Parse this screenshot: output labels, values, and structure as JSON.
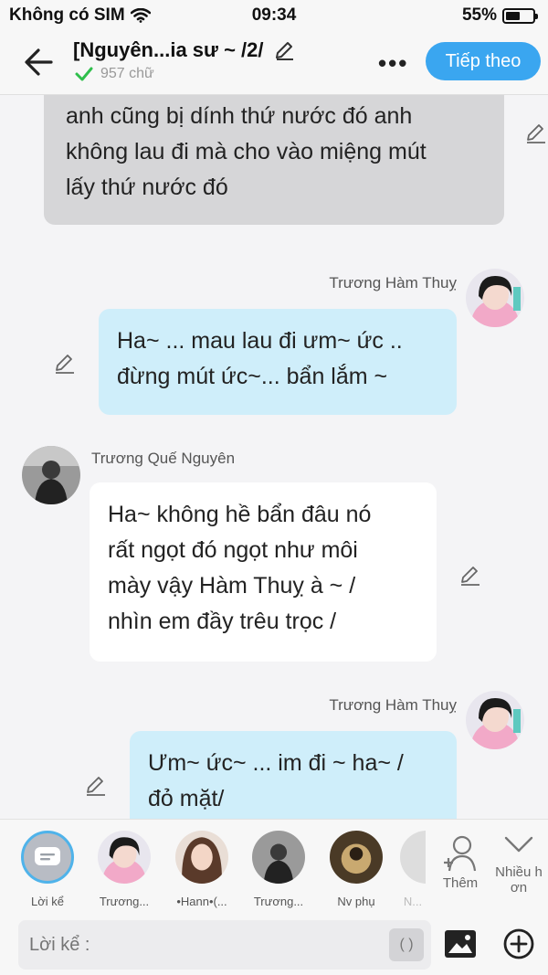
{
  "status_bar": {
    "carrier": "Không có SIM",
    "time": "09:34",
    "battery_percent": "55%",
    "battery_level": 0.55
  },
  "header": {
    "title": "[Nguyên...ia sư ~ /2/",
    "word_count": "957 chữ",
    "next_label": "Tiếp theo"
  },
  "messages": [
    {
      "type": "left-gray",
      "text_lines": [
        "anh cũng bị dính thứ nước đó anh",
        "không lau đi mà cho vào miệng mút",
        "lấy thứ nước đó"
      ]
    },
    {
      "type": "right",
      "name": "Trương Hàm Thuỵ",
      "text_lines": [
        "Ha~ ... mau lau đi ưm~ ức ..",
        "đừng mút ức~... bẩn lắm ~"
      ]
    },
    {
      "type": "left",
      "name": "Trương Quế Nguyên",
      "text_lines": [
        "Ha~ không hề bẩn đâu nó",
        "rất ngọt đó ngọt như môi",
        "mày vậy Hàm Thuỵ à ~ /",
        "nhìn em đầy trêu trọc /"
      ]
    },
    {
      "type": "right",
      "name": "Trương Hàm Thuỵ",
      "text_lines": [
        "Ưm~ ức~ ... im đi ~ ha~ /",
        "đỏ mặt/"
      ]
    }
  ],
  "characters": [
    {
      "label": "Lời kể",
      "icon": "narrator-icon"
    },
    {
      "label": "Trương..."
    },
    {
      "label": "•Hann•(..."
    },
    {
      "label": "Trương..."
    },
    {
      "label": "Nv phụ"
    },
    {
      "label": "N..."
    }
  ],
  "add_label": "Thêm",
  "more_label_line1": "Nhiều h",
  "more_label_line2": "ơn",
  "input": {
    "placeholder": "Lời kể :",
    "paren": "( )"
  },
  "colors": {
    "accent": "#3aa6f0",
    "bubble_blue": "#cfeefa",
    "bubble_gray": "#d6d6d8",
    "check_green": "#2fbf4c"
  }
}
